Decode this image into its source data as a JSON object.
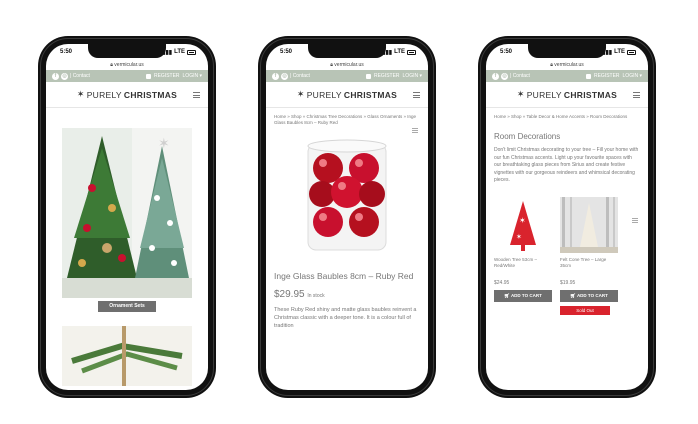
{
  "status": {
    "time": "5:50",
    "network": "LTE"
  },
  "url": "vermicular.us",
  "topbar": {
    "contact": "| Contact",
    "register": "REGISTER",
    "login": "LOGIN"
  },
  "logo": {
    "light": "PURELY",
    "bold": "CHRISTMAS"
  },
  "phone1": {
    "category_label": "Ornament Sets"
  },
  "phone2": {
    "breadcrumb": "Home » Shop » Christmas Tree Decorations » Glass Ornaments » Inge Glass Baubles 8cm – Ruby Red",
    "product_title": "Inge Glass Baubles 8cm – Ruby Red",
    "price": "$29.95",
    "stock": "In stock",
    "description": "These Ruby Red shiny and matte glass baubles reinvent a Christmas classic with a deeper tone. It is a colour full of tradition"
  },
  "phone3": {
    "breadcrumb": "Home » Shop » Table Decor & Home Accents » Room Decorations",
    "section_title": "Room Decorations",
    "section_description": "Don't limit Christmas decorating to your tree – Fill your home with our fun Christmas accents. Light up your favourite spaces with our breathtaking glass pieces from Sirius and create festive vignettes with our gorgeous reindeers and whimsical decorating pieces.",
    "products": [
      {
        "name": "Wooden Tree 53cm – Red/White",
        "price": "$24.95",
        "button": "ADD TO CART"
      },
      {
        "name": "Felt Cone Tree – Large 35cm",
        "price": "$19.95",
        "button": "ADD TO CART",
        "badge": "Sold Out"
      }
    ]
  },
  "colors": {
    "topbar": "#b8c4b6",
    "button": "#6f6f6f",
    "sold_out": "#d9232d",
    "bauble": "#c8102e"
  }
}
